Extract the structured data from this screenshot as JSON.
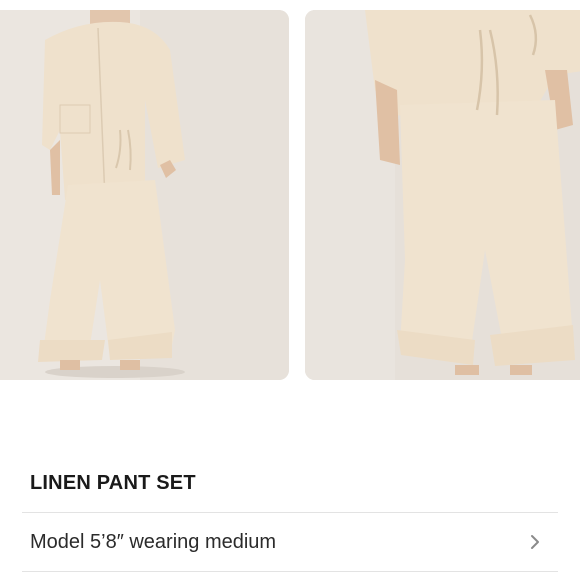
{
  "product": {
    "title": "LINEN PANT SET"
  },
  "details_row": {
    "label": "Model 5’8″ wearing medium",
    "icon": "chevron-right-icon"
  },
  "gallery": {
    "images": [
      {
        "name": "product-photo-full-outfit"
      },
      {
        "name": "product-photo-pants-closeup"
      }
    ]
  },
  "colors": {
    "linen": "#efe0c9",
    "backdrop": "#e9e4de",
    "text": "#1a1a1a",
    "divider": "#e3e3e3"
  }
}
